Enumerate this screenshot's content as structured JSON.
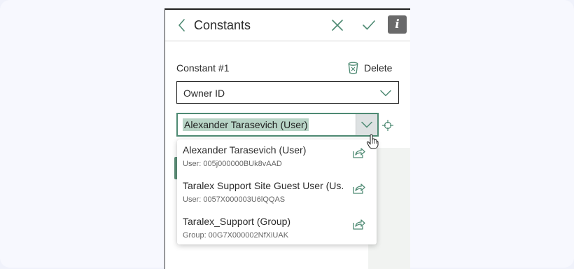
{
  "header": {
    "title": "Constants",
    "info_label": "i"
  },
  "constant": {
    "label": "Constant #1",
    "delete_label": "Delete"
  },
  "field_select": {
    "value": "Owner ID"
  },
  "value_combobox": {
    "value": "Alexander Tarasevich (User)"
  },
  "dropdown": {
    "options": [
      {
        "title": "Alexander Tarasevich (User)",
        "subtitle": "User: 005j000000BUk8vAAD"
      },
      {
        "title": "Taralex Support Site Guest User (Us...",
        "subtitle": "User: 0057X000003U6lQQAS"
      },
      {
        "title": "Taralex_Support (Group)",
        "subtitle": "Group: 00G7X000002NfXiUAK"
      }
    ]
  },
  "colors": {
    "accent": "#4e8a73",
    "selection_highlight": "#b8d4c6",
    "button_green": "#5e9179",
    "info_bg": "#6a6a6a"
  },
  "icons": [
    "chevron-left-icon",
    "close-icon",
    "check-icon",
    "info-icon",
    "trash-icon",
    "chevron-down-icon",
    "crosshair-icon",
    "share-icon",
    "hand-cursor-icon"
  ]
}
